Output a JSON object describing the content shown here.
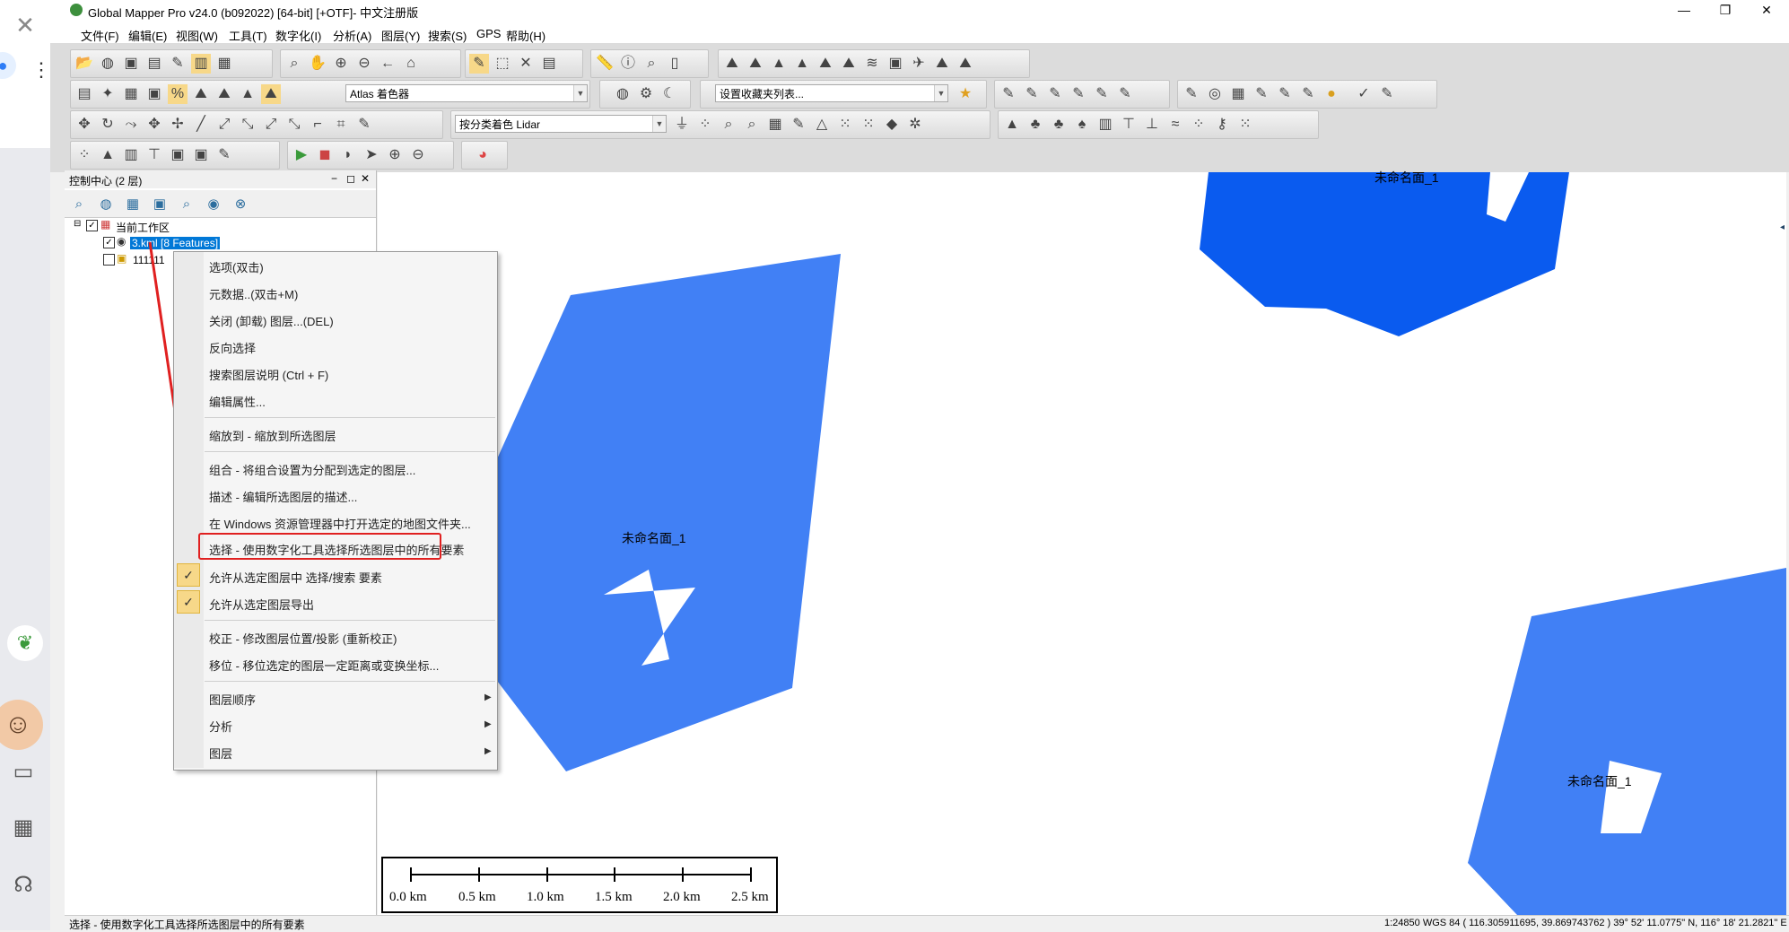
{
  "window": {
    "title": "Global Mapper Pro v24.0 (b092022) [64-bit] [+OTF]- 中文注册版",
    "minimize": "—",
    "restore": "❐",
    "close": "✕"
  },
  "menubar": {
    "items": [
      "文件(F)",
      "编辑(E)",
      "视图(W)",
      "工具(T)",
      "数字化(I)",
      "分析(A)",
      "图层(Y)",
      "搜索(S)",
      "GPS",
      "帮助(H)"
    ]
  },
  "toolbars": {
    "atlas_combo": "Atlas 着色器",
    "favorites_combo": "设置收藏夹列表...",
    "lidar_combo": "按分类着色 Lidar"
  },
  "control_center": {
    "title": "控制中心 (2 层)",
    "tree": {
      "root": "当前工作区",
      "layer1": "3.kml [8 Features]",
      "layer2": "111111"
    }
  },
  "context_menu": {
    "items": [
      "选项(双击)",
      "元数据..(双击+M)",
      "关闭 (卸载) 图层...(DEL)",
      "反向选择",
      "搜索图层说明 (Ctrl + F)",
      "编辑属性...",
      "缩放到 - 缩放到所选图层",
      "组合 - 将组合设置为分配到选定的图层...",
      "描述 - 编辑所选图层的描述...",
      "在 Windows 资源管理器中打开选定的地图文件夹...",
      "选择 - 使用数字化工具选择所选图层中的所有要素",
      "允许从选定图层中 选择/搜索 要素",
      "允许从选定图层导出",
      "校正 - 修改图层位置/投影 (重新校正)",
      "移位 - 移位选定的图层一定距离或变换坐标...",
      "图层顺序",
      "分析",
      "图层"
    ],
    "checked": [
      true,
      true
    ]
  },
  "map": {
    "polygon_labels": [
      "未命名面_1",
      "未命名面_1",
      "未命名面_1"
    ],
    "fill_light": "#4180f5",
    "fill_dark": "#0a5bef",
    "scalebar": [
      "0.0 km",
      "0.5 km",
      "1.0 km",
      "1.5 km",
      "2.0 km",
      "2.5 km"
    ]
  },
  "status": {
    "message": "选择 - 使用数字化工具选择所选图层中的所有要素",
    "coords": "1:24850  WGS 84 ( 116.305911695, 39.869743762 )  39° 52' 11.0775\" N, 116° 18' 21.2821\" E"
  },
  "sidebar_external": {
    "icons": [
      "close-icon",
      "user-icon",
      "more-icon",
      "leaf-icon",
      "avatar-icon",
      "coupon-icon",
      "qr-icon",
      "headset-icon"
    ]
  }
}
